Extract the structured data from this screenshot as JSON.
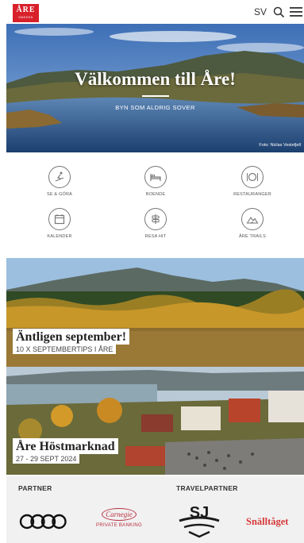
{
  "header": {
    "logo_text": "ÅRE",
    "logo_subtext": "SWEDEN",
    "language": "SV",
    "icons": {
      "search": "search-icon",
      "menu": "hamburger-menu-icon"
    },
    "brand_color": "#d8202b"
  },
  "hero": {
    "title": "Välkommen till Åre!",
    "subtitle": "BYN SOM ALDRIG SOVER",
    "photo_credit": "Foto: Niclas Vestefjell"
  },
  "categories": [
    {
      "label": "SE & GÖRA",
      "icon": "ski-activity-icon"
    },
    {
      "label": "BOENDE",
      "icon": "bed-icon"
    },
    {
      "label": "RESTAURANGER",
      "icon": "plate-cutlery-icon"
    },
    {
      "label": "KALENDER",
      "icon": "calendar-icon"
    },
    {
      "label": "RESA HIT",
      "icon": "signpost-icon"
    },
    {
      "label": "ÅRE TRAILS",
      "icon": "trail-mountain-icon"
    }
  ],
  "articles": [
    {
      "title": "Äntligen september!",
      "subtitle": "10 X SEPTEMBERTIPS I ÅRE"
    },
    {
      "title": "Åre Höstmarknad",
      "subtitle": "27 - 29 SEPT 2024"
    }
  ],
  "partners": {
    "partner_label": "PARTNER",
    "travelpartner_label": "TRAVELPARTNER",
    "carnegie_name": "Carnegie",
    "carnegie_sub": "PRIVATE BANKING",
    "snalltaget": "Snälltåget",
    "logos": [
      "audi-logo",
      "carnegie-logo",
      "sj-logo",
      "snalltaget-logo"
    ]
  }
}
